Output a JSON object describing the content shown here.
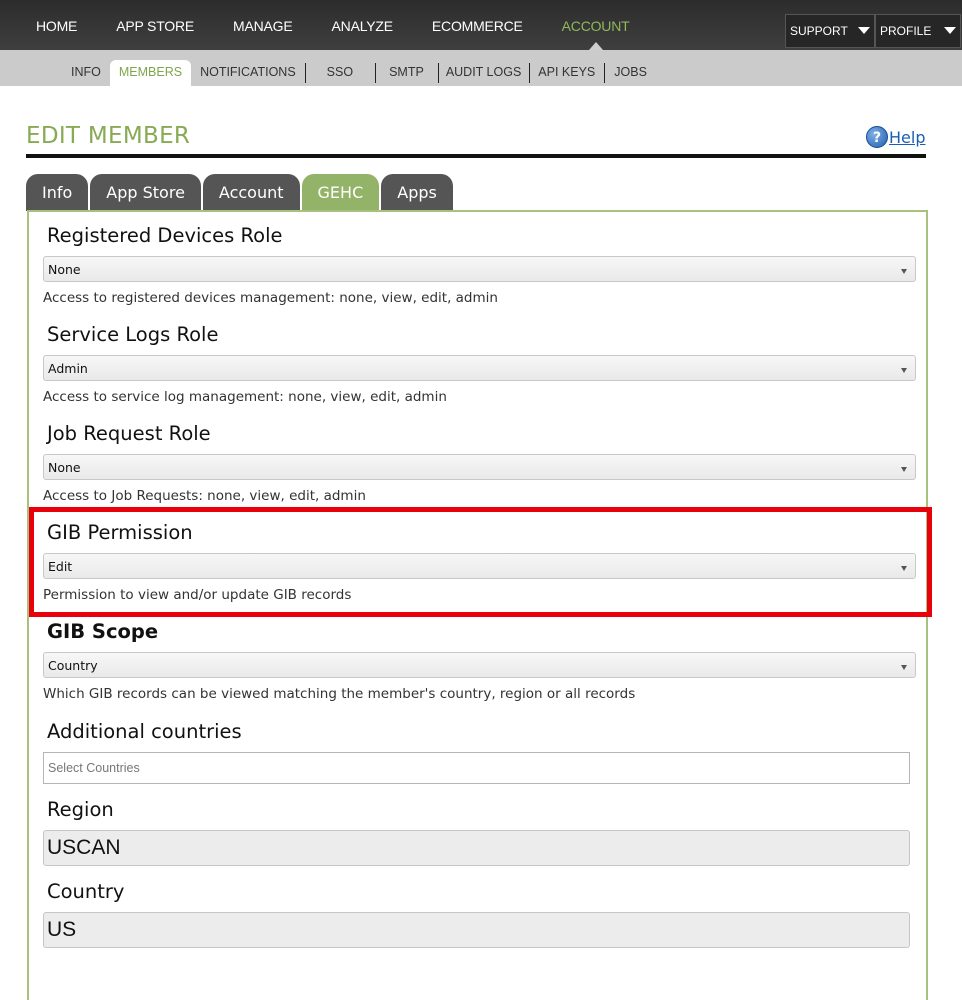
{
  "topnav": {
    "items": [
      "HOME",
      "APP STORE",
      "MANAGE",
      "ANALYZE",
      "ECOMMERCE",
      "ACCOUNT"
    ],
    "active": "ACCOUNT",
    "support_label": "SUPPORT",
    "profile_label": "PROFILE"
  },
  "subnav": {
    "items": [
      "INFO",
      "MEMBERS",
      "NOTIFICATIONS",
      "SSO",
      "SMTP",
      "AUDIT LOGS",
      "API KEYS",
      "JOBS"
    ],
    "active": "MEMBERS"
  },
  "page": {
    "title": "EDIT MEMBER",
    "help_label": "Help",
    "help_icon": "question-icon"
  },
  "tabs": [
    "Info",
    "App Store",
    "Account",
    "GEHC",
    "Apps"
  ],
  "active_tab": "GEHC",
  "fields": {
    "registered_devices": {
      "label": "Registered Devices Role",
      "value": "None",
      "hint": "Access to registered devices management: none, view, edit, admin"
    },
    "service_logs": {
      "label": "Service Logs Role",
      "value": "Admin",
      "hint": "Access to service log management: none, view, edit, admin"
    },
    "job_request": {
      "label": "Job Request Role",
      "value": "None",
      "hint": "Access to Job Requests: none, view, edit, admin"
    },
    "gib_permission": {
      "label": "GIB Permission",
      "value": "Edit",
      "hint": "Permission to view and/or update GIB records"
    },
    "gib_scope": {
      "label": "GIB Scope",
      "value": "Country",
      "hint": "Which GIB records can be viewed matching the member's country, region or all records"
    },
    "additional_countries": {
      "label": "Additional countries",
      "placeholder": "Select Countries"
    },
    "region": {
      "label": "Region",
      "value": "USCAN"
    },
    "country": {
      "label": "Country",
      "value": "US"
    }
  },
  "colors": {
    "accent_green": "#88aa55",
    "tab_active": "#93b468",
    "tab_inactive": "#555555",
    "highlight_red": "#e8000a"
  }
}
